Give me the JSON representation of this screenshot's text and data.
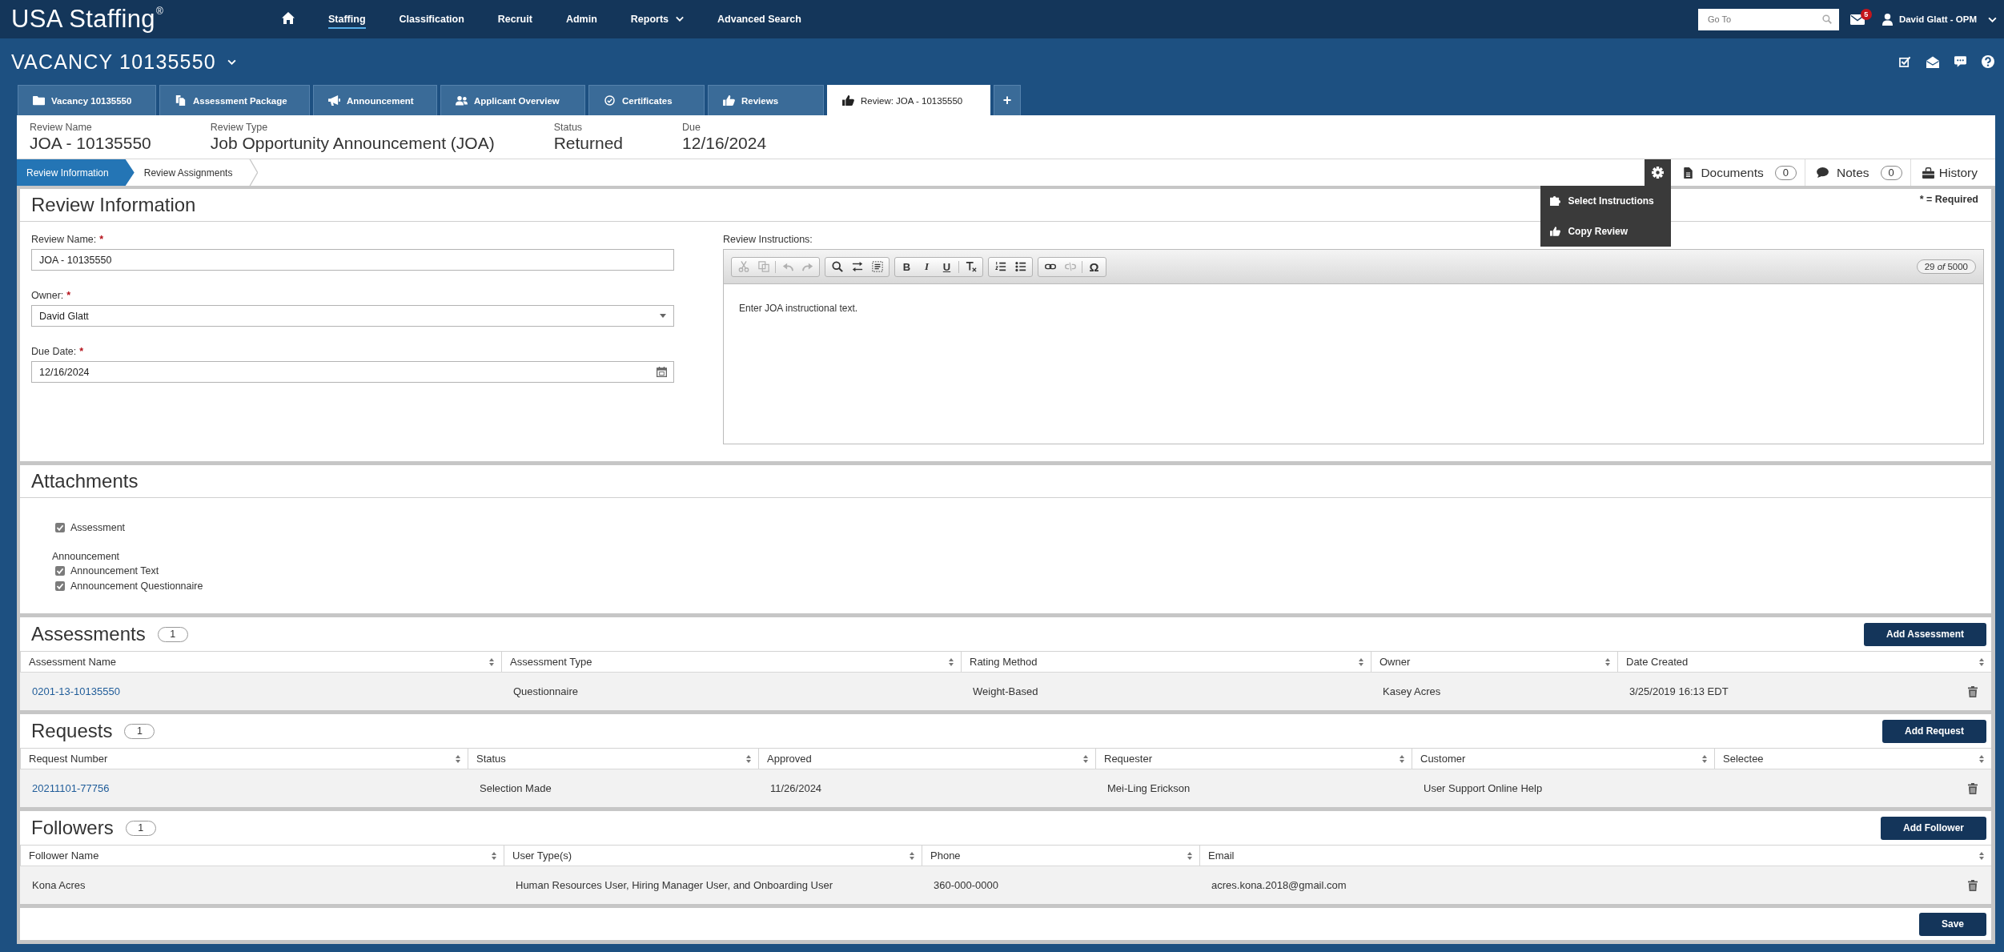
{
  "top_nav": {
    "logo": "USA Staffing",
    "logo_mark": "®",
    "items": [
      {
        "kind": "home",
        "selected": false
      },
      {
        "kind": "link",
        "label": "Staffing",
        "selected": true
      },
      {
        "kind": "link",
        "label": "Classification",
        "selected": false
      },
      {
        "kind": "link",
        "label": "Recruit",
        "selected": false
      },
      {
        "kind": "link",
        "label": "Admin",
        "selected": false
      },
      {
        "kind": "menu",
        "label": "Reports",
        "selected": false
      },
      {
        "kind": "link",
        "label": "Advanced Search",
        "selected": false
      }
    ],
    "search": {
      "placeholder": "Go To"
    },
    "mail_badge": "5",
    "user": "David Glatt - OPM"
  },
  "vacancy": {
    "title": "VACANCY 10135550"
  },
  "tabs": [
    {
      "label": "Vacancy 10135550",
      "selected": false
    },
    {
      "label": "Assessment Package",
      "selected": false
    },
    {
      "label": "Announcement",
      "selected": false
    },
    {
      "label": "Applicant Overview",
      "selected": false
    },
    {
      "label": "Certificates",
      "selected": false
    },
    {
      "label": "Reviews",
      "selected": false
    },
    {
      "label": "Review: JOA - 10135550",
      "selected": true
    }
  ],
  "add_tab": "+",
  "summary": [
    {
      "label": "Review Name",
      "value": "JOA - 10135550"
    },
    {
      "label": "Review Type",
      "value": "Job Opportunity Announcement (JOA)"
    },
    {
      "label": "Status",
      "value": "Returned"
    },
    {
      "label": "Due",
      "value": "12/16/2024"
    }
  ],
  "steps": [
    {
      "label": "Review Information",
      "selected": true
    },
    {
      "label": "Review Assignments",
      "selected": false
    }
  ],
  "gear_menu": {
    "expanded": true,
    "items": [
      {
        "label": "Select Instructions"
      },
      {
        "label": "Copy Review"
      }
    ]
  },
  "actions": [
    {
      "label": "Documents",
      "count": "0"
    },
    {
      "label": "Notes",
      "count": "0"
    },
    {
      "label": "History"
    }
  ],
  "review_info": {
    "title": "Review Information",
    "required_note": "* = Required",
    "fields": [
      {
        "kind": "text",
        "label": "Review Name:",
        "required_mark": "*",
        "value": "JOA - 10135550"
      },
      {
        "kind": "select",
        "label": "Owner:",
        "required_mark": "*",
        "value": "David Glatt"
      },
      {
        "kind": "date",
        "label": "Due Date:",
        "required_mark": "*",
        "value": "12/16/2024"
      }
    ],
    "instructions": {
      "label": "Review Instructions:",
      "toolbar": [
        {
          "items": [
            {
              "kind": "cut",
              "disabled": true
            },
            {
              "kind": "copy",
              "disabled": true
            },
            {
              "kind": "separator"
            },
            {
              "kind": "undo",
              "disabled": true
            },
            {
              "kind": "redo",
              "disabled": true
            }
          ]
        },
        {
          "items": [
            {
              "kind": "find",
              "disabled": false
            },
            {
              "kind": "replace",
              "disabled": false
            },
            {
              "kind": "select_all",
              "disabled": false
            }
          ]
        },
        {
          "items": [
            {
              "kind": "bold",
              "label": "B",
              "disabled": false
            },
            {
              "kind": "italic",
              "label": "I",
              "disabled": false
            },
            {
              "kind": "underline",
              "label": "U",
              "disabled": false
            },
            {
              "kind": "separator"
            },
            {
              "kind": "clear_format",
              "disabled": false
            }
          ]
        },
        {
          "items": [
            {
              "kind": "numbered_list",
              "disabled": false
            },
            {
              "kind": "bulleted_list",
              "disabled": false
            }
          ]
        },
        {
          "items": [
            {
              "kind": "link",
              "disabled": false
            },
            {
              "kind": "unlink",
              "disabled": true
            },
            {
              "kind": "separator"
            },
            {
              "kind": "special_char",
              "label": "Ω",
              "disabled": false
            }
          ]
        }
      ],
      "counter": "29 *of* 5000",
      "text": "Enter JOA instructional text."
    }
  },
  "attachments": {
    "title": "Attachments",
    "items": [
      {
        "kind": "checkbox",
        "label": "Assessment",
        "checked": true
      },
      {
        "kind": "heading",
        "label": "Announcement"
      },
      {
        "kind": "checkbox",
        "label": "Announcement Text",
        "checked": true
      },
      {
        "kind": "checkbox",
        "label": "Announcement Questionnaire",
        "checked": true
      }
    ]
  },
  "sections": [
    {
      "title": "Assessments",
      "count": "1",
      "button": "Add Assessment",
      "columns": [
        "Assessment Name",
        "Assessment Type",
        "Rating Method",
        "Owner",
        "Date Created"
      ],
      "rows": [
        {
          "cells": [
            {
              "kind": "link",
              "text": "0201-13-10135550"
            },
            {
              "kind": "text",
              "text": "Questionnaire"
            },
            {
              "kind": "text",
              "text": "Weight-Based"
            },
            {
              "kind": "text",
              "text": "Kasey Acres"
            },
            {
              "kind": "text",
              "text": "3/25/2019 16:13 EDT"
            }
          ]
        }
      ]
    },
    {
      "title": "Requests",
      "count": "1",
      "button": "Add Request",
      "columns": [
        "Request Number",
        "Status",
        "Approved",
        "Requester",
        "Customer",
        "Selectee"
      ],
      "rows": [
        {
          "cells": [
            {
              "kind": "link",
              "text": "20211101-77756"
            },
            {
              "kind": "text",
              "text": "Selection Made"
            },
            {
              "kind": "text",
              "text": "11/26/2024"
            },
            {
              "kind": "text",
              "text": "Mei-Ling Erickson"
            },
            {
              "kind": "text",
              "text": "User Support Online Help"
            }
          ]
        }
      ]
    },
    {
      "title": "Followers",
      "count": "1",
      "button": "Add Follower",
      "columns": [
        "Follower Name",
        "User Type(s)",
        "Phone",
        "Email"
      ],
      "rows": [
        {
          "cells": [
            {
              "kind": "text",
              "text": "Kona Acres"
            },
            {
              "kind": "text",
              "text": "Human Resources User, Hiring Manager User, and Onboarding User"
            },
            {
              "kind": "text",
              "text": "360-000-0000"
            },
            {
              "kind": "text",
              "text": "acres.kona.2018@gmail.com"
            }
          ]
        }
      ]
    }
  ],
  "save_button": "Save"
}
